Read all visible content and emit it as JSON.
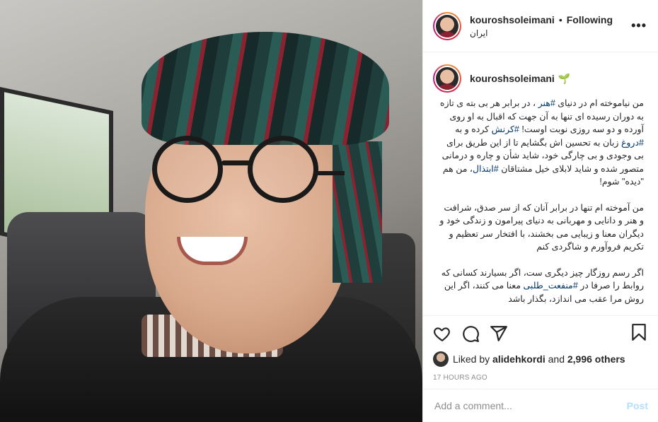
{
  "post": {
    "author": "kouroshsoleimani",
    "separator": "•",
    "follow_status": "Following",
    "location": "ایران",
    "more_icon": "more-horizontal-icon",
    "photo_description_icon": "profile-photo"
  },
  "caption": {
    "username": "kouroshsoleimani",
    "leaf_icon": "🌱",
    "paragraphs": [
      [
        "من نیاموخته ام در دنیای ",
        "#هنر",
        " ، در برابر هر بی بته ی تازه به دوران رسیده ای تنها به آن جهت که اقبال به او روی آورده و دو سه روزی نوبت اوست! ",
        "#کرنش",
        " کرده و به ",
        "#دروغ",
        " زبان به تحسین اش بگشایم تا از این طریق برای بی وجودی و بی چارگی خود، شاید شأن و چاره و درمانی متصور شده و شاید لابلای خیل مشتاقان ",
        "#ابتذال",
        "، من هم \"دیده\" شوم!"
      ],
      [
        "من آموخته ام تنها در برابر آنان که از سر صدق، شرافت و هنر و دانایی و مهربانی به دنیای پیرامون و زندگی خود و دیگران معنا و زیبایی می بخشند، با افتخار سر تعظیم و تکریم فروآورم و شاگردی کنم"
      ],
      [
        "اگر رسم روزگار چیز دیگری ست، اگر بسیارند کسانی که روابط را صرفا در ",
        "#منفعت_طلبی",
        " معنا می کنند، اگر این روش مرا عقب می اندازد، بگذار باشد"
      ]
    ]
  },
  "actions": {
    "like_icon": "heart-icon",
    "comment_icon": "comment-icon",
    "share_icon": "paper-plane-icon",
    "save_icon": "bookmark-icon"
  },
  "likes": {
    "prefix": "Liked by ",
    "user": "alidehkordi",
    "middle": " and ",
    "count": "2,996 others"
  },
  "time_ago": "17 HOURS AGO",
  "comment": {
    "placeholder": "Add a comment...",
    "post_label": "Post"
  },
  "colors": {
    "link": "#00376b",
    "post_button_disabled": "#b2dffc",
    "muted": "#8e8e8e",
    "border": "#efefef"
  }
}
